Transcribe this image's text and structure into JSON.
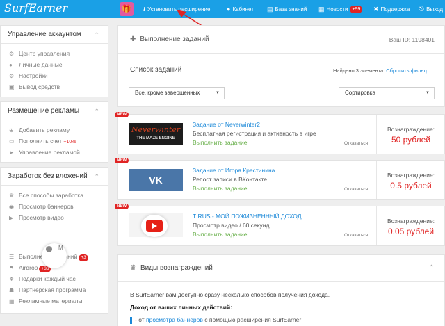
{
  "topbar": {
    "logo": "SurfEarner",
    "nav": [
      {
        "icon": "download-icon",
        "glyph": "⭳",
        "label": "Установить расширение"
      },
      {
        "icon": "user-icon",
        "glyph": "👤",
        "label": "Кабинет"
      },
      {
        "icon": "book-icon",
        "glyph": "📖",
        "label": "База знаний"
      },
      {
        "icon": "news-icon",
        "glyph": "▤",
        "label": "Новости",
        "badge": "+99"
      },
      {
        "icon": "support-icon",
        "glyph": "✖",
        "label": "Поддержка"
      },
      {
        "icon": "logout-icon",
        "glyph": "⎋",
        "label": "Выход"
      }
    ]
  },
  "sidebar": {
    "account": {
      "title": "Управление аккаунтом",
      "items": [
        {
          "icon": "dashboard-icon",
          "glyph": "⚙",
          "label": "Центр управления"
        },
        {
          "icon": "user-icon",
          "glyph": "👤",
          "label": "Личные данные"
        },
        {
          "icon": "gear-icon",
          "glyph": "⚙",
          "label": "Настройки"
        },
        {
          "icon": "card-icon",
          "glyph": "▣",
          "label": "Вывод средств"
        }
      ]
    },
    "ads": {
      "title": "Размещение рекламы",
      "items": [
        {
          "icon": "plus-icon",
          "glyph": "⊕",
          "label": "Добавить рекламу",
          "extra": ""
        },
        {
          "icon": "wallet-icon",
          "glyph": "▭",
          "label": "Пополнить счет",
          "extra": "+10%"
        },
        {
          "icon": "send-icon",
          "glyph": "➤",
          "label": "Управление рекламой",
          "extra": ""
        }
      ]
    },
    "earn": {
      "title": "Заработок без вложений",
      "items": [
        {
          "icon": "trophy-icon",
          "glyph": "🏆",
          "label": "Все способы заработка",
          "badge": ""
        },
        {
          "icon": "eye-icon",
          "glyph": "◉",
          "label": "Просмотр баннеров",
          "badge": ""
        },
        {
          "icon": "play-icon",
          "glyph": "▶",
          "label": "Просмотр видео",
          "badge": ""
        }
      ],
      "spinner_text": "М",
      "items2": [
        {
          "icon": "list-icon",
          "glyph": "☰",
          "label": "Выполнение заданий",
          "badge": "+3"
        },
        {
          "icon": "airdrop-icon",
          "glyph": "⚑",
          "label": "Airdrop",
          "badge": "+33"
        },
        {
          "icon": "gift-icon",
          "glyph": "🎁",
          "label": "Подарки каждый час",
          "badge": ""
        },
        {
          "icon": "partner-icon",
          "glyph": "👥",
          "label": "Партнерская программа",
          "badge": ""
        },
        {
          "icon": "materials-icon",
          "glyph": "▦",
          "label": "Рекламные материалы",
          "badge": ""
        }
      ]
    }
  },
  "main": {
    "title": "Выполнение заданий",
    "user_id": "Ваш ID: 1198401",
    "list_title": "Список заданий",
    "found": "Найдено 3 элемента",
    "reset_filter": "Сбросить фильтр",
    "filter_select": "Все, кроме завершенных",
    "sort_select": "Сортировка",
    "tasks": [
      {
        "new": "NEW",
        "thumb": "neverwinter",
        "thumb_text": "Neverwinter",
        "thumb_sub": "THE MAZE ENGINE",
        "title": "Задание от Neverwinter2",
        "desc": "Бесплатная регистрация и активность в игре",
        "action": "Выполнить задание",
        "cancel": "Отказаться",
        "reward_label": "Вознаграждение:",
        "reward": "50 рублей"
      },
      {
        "new": "NEW",
        "thumb": "vk",
        "thumb_text": "VK",
        "title": "Задание от Игоря Крестинина",
        "desc": "Репост записи в ВКонтакте",
        "action": "Выполнить задание",
        "cancel": "Отказаться",
        "reward_label": "Вознаграждение:",
        "reward": "0.5 рублей"
      },
      {
        "new": "NEW",
        "thumb": "youtube",
        "title": "TIRUS - МОЙ ПОЖИЗНЕННЫЙ ДОХОД",
        "desc": "Просмотр видео / 60 секунд",
        "action": "Выполнить задание",
        "cancel": "Отказаться",
        "reward_label": "Вознаграждение:",
        "reward": "0.05 рублей"
      }
    ],
    "rewards": {
      "title": "Виды вознаграждений",
      "intro": "В SurfEarner вам доступно сразу несколько способов получения дохода.",
      "subtitle": "Доход от ваших личных действий:",
      "line_prefix": "- от ",
      "line_link": "просмотра баннеров",
      "line_suffix": " с помощью расширения SurfEarner"
    }
  },
  "colors": {
    "topbar": "#1aa0e6",
    "accent_red": "#e02424",
    "link": "#1a88d8",
    "green": "#6ab04c"
  }
}
